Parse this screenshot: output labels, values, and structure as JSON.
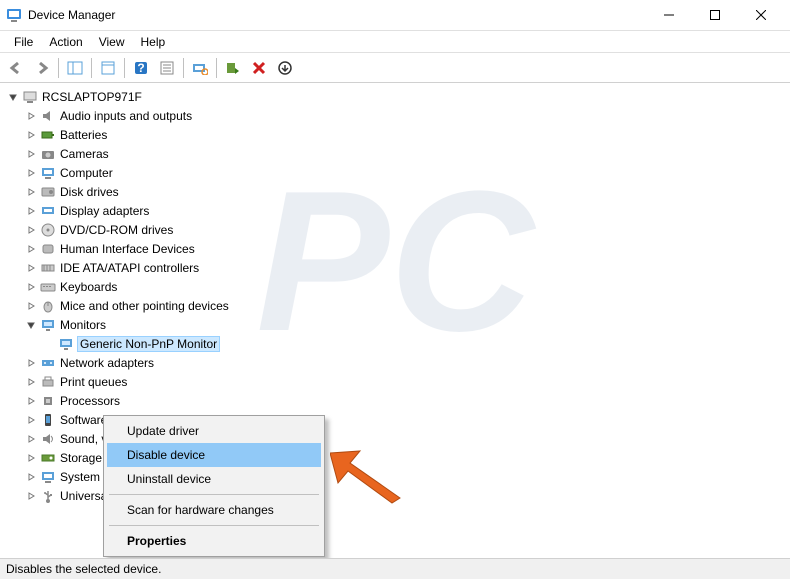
{
  "window": {
    "title": "Device Manager"
  },
  "menu": {
    "file": "File",
    "action": "Action",
    "view": "View",
    "help": "Help"
  },
  "tree": {
    "root": "RCSLAPTOP971F",
    "items": [
      "Audio inputs and outputs",
      "Batteries",
      "Cameras",
      "Computer",
      "Disk drives",
      "Display adapters",
      "DVD/CD-ROM drives",
      "Human Interface Devices",
      "IDE ATA/ATAPI controllers",
      "Keyboards",
      "Mice and other pointing devices",
      "Monitors",
      "Network adapters",
      "Print queues",
      "Processors",
      "Software devices",
      "Sound, video and game controllers",
      "Storage controllers",
      "System devices",
      "Universal Serial Bus controllers"
    ],
    "monitors_child": "Generic Non-PnP Monitor"
  },
  "context_menu": {
    "update": "Update driver",
    "disable": "Disable device",
    "uninstall": "Uninstall device",
    "scan": "Scan for hardware changes",
    "properties": "Properties"
  },
  "statusbar": {
    "text": "Disables the selected device."
  },
  "icons": {
    "app": "device-manager-icon",
    "minimize": "minimize-icon",
    "maximize": "maximize-icon",
    "close": "close-icon"
  },
  "colors": {
    "selection": "#cce8ff",
    "context_highlight": "#91c9f7",
    "arrow": "#e8651f"
  }
}
